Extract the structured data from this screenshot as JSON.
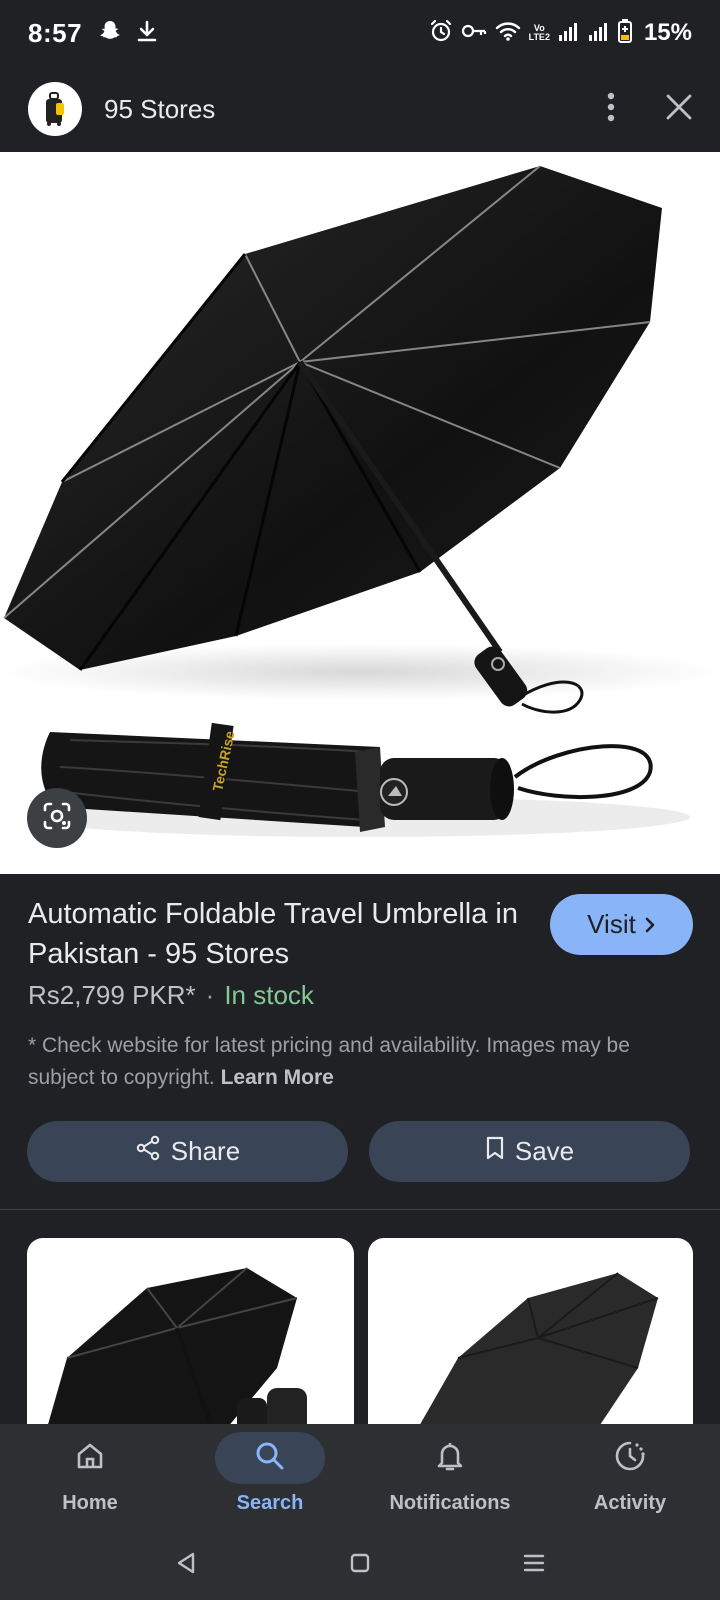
{
  "status_bar": {
    "time": "8:57",
    "volte_top": "Vo",
    "volte_bottom": "LTE2",
    "battery_percent": "15%",
    "icons": [
      "snapchat-icon",
      "download-icon",
      "alarm-icon",
      "vpn-key-icon",
      "wifi-icon",
      "signal-icon",
      "signal-icon",
      "battery-icon"
    ]
  },
  "header": {
    "store_name": "95 Stores",
    "icons": [
      "store-logo",
      "more-vert-icon",
      "close-icon"
    ]
  },
  "product": {
    "brand_text": "TechRise",
    "title": "Automatic Foldable Travel Umbrella in Pakistan - 95 Stores",
    "price": "Rs2,799 PKR*",
    "separator": "·",
    "availability": "In stock",
    "disclaimer": "* Check website for latest pricing and availability. Images may be subject to copyright.",
    "learn_more": "Learn More",
    "visit_label": "Visit",
    "share_label": "Share",
    "save_label": "Save"
  },
  "bottom_nav": {
    "items": [
      {
        "label": "Home",
        "icon": "home-icon",
        "active": false
      },
      {
        "label": "Search",
        "icon": "search-icon",
        "active": true
      },
      {
        "label": "Notifications",
        "icon": "bell-icon",
        "active": false
      },
      {
        "label": "Activity",
        "icon": "activity-icon",
        "active": false
      }
    ]
  },
  "colors": {
    "background": "#202124",
    "accent": "#8ab4f8",
    "button_bg": "#394457",
    "in_stock": "#81c995",
    "nav_bg": "#2d2f33"
  }
}
